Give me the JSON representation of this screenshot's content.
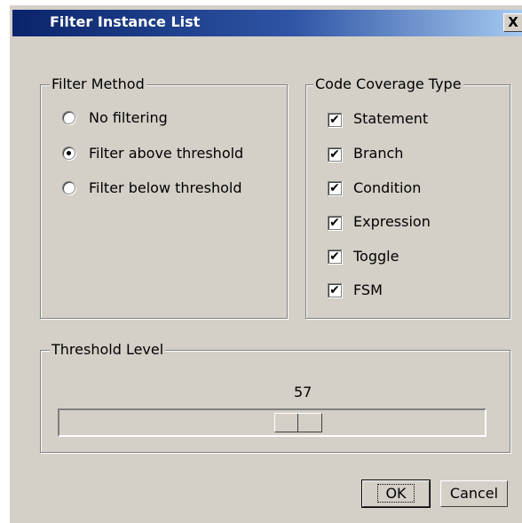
{
  "dialog": {
    "title": "Filter Instance List",
    "close_label": "X"
  },
  "filter_method": {
    "legend": "Filter Method",
    "options": [
      {
        "label": "No filtering",
        "checked": false
      },
      {
        "label": "Filter above threshold",
        "checked": true
      },
      {
        "label": "Filter below threshold",
        "checked": false
      }
    ]
  },
  "coverage": {
    "legend": "Code Coverage Type",
    "items": [
      {
        "label": "Statement",
        "checked": true
      },
      {
        "label": "Branch",
        "checked": true
      },
      {
        "label": "Condition",
        "checked": true
      },
      {
        "label": "Expression",
        "checked": true
      },
      {
        "label": "Toggle",
        "checked": true
      },
      {
        "label": "FSM",
        "checked": true
      }
    ],
    "check_glyph": "✔"
  },
  "threshold": {
    "legend": "Threshold Level",
    "value": "57",
    "min": 0,
    "max": 100
  },
  "buttons": {
    "ok": "OK",
    "cancel": "Cancel"
  }
}
